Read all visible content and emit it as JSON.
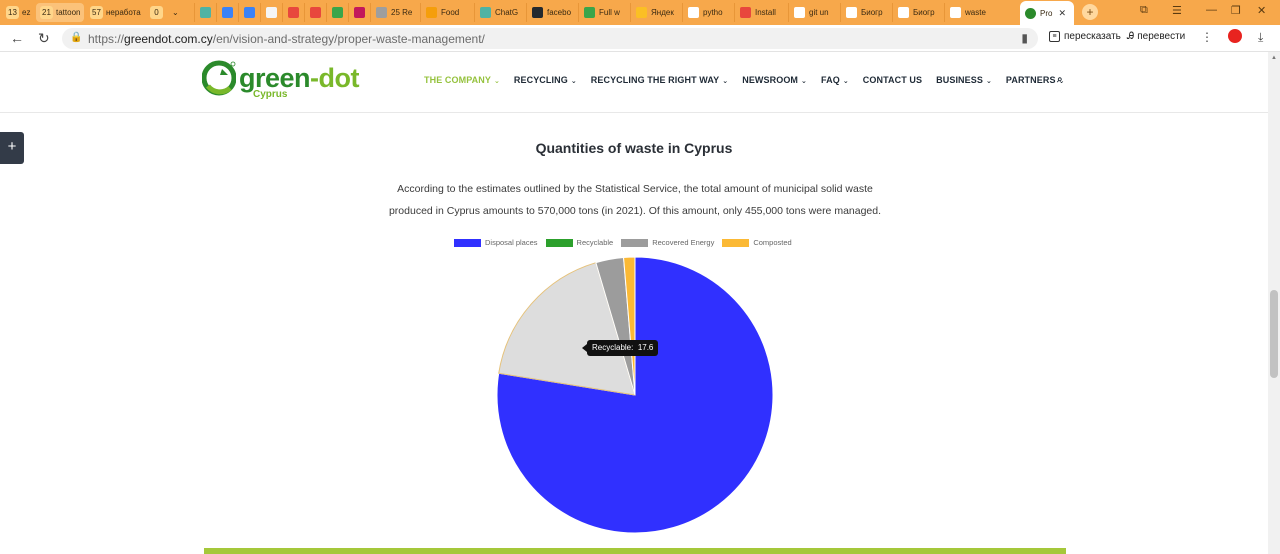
{
  "browser": {
    "tab_groups": [
      {
        "count": "13",
        "label": "ez"
      },
      {
        "count": "21",
        "label": "tattoon"
      },
      {
        "count": "57",
        "label": "неработа"
      },
      {
        "count": "0",
        "label": ""
      }
    ],
    "tabs": [
      {
        "label": "",
        "color": "#4fb3a3"
      },
      {
        "label": "",
        "color": "#3b82f6"
      },
      {
        "label": "",
        "color": "#3b82f6"
      },
      {
        "label": "",
        "color": "#f5f5f5"
      },
      {
        "label": "",
        "color": "#e8473d"
      },
      {
        "label": "",
        "color": "#e8473d"
      },
      {
        "label": "",
        "color": "#3aa54a"
      },
      {
        "label": "",
        "color": "#c2185b"
      },
      {
        "label": "25 Re",
        "color": "#9e9e9e"
      },
      {
        "label": "Food",
        "color": "#f59e0b"
      },
      {
        "label": "ChatG",
        "color": "#4fb3a3"
      },
      {
        "label": "facebo",
        "color": "#24292e"
      },
      {
        "label": "Full w",
        "color": "#3aa54a"
      },
      {
        "label": "Яндек",
        "color": "#fbbf24"
      },
      {
        "label": "pytho",
        "color": "#ffffff"
      },
      {
        "label": "Install",
        "color": "#e8473d"
      },
      {
        "label": "git un",
        "color": "#ffffff"
      },
      {
        "label": "Биогр",
        "color": "#ffffff"
      },
      {
        "label": "Биогр",
        "color": "#ffffff"
      },
      {
        "label": "waste",
        "color": "#ffffff"
      }
    ],
    "active_tab": {
      "label": "Pro"
    },
    "url": {
      "scheme": "https://",
      "host": "greendot.com.cy",
      "path": "/en/vision-and-strategy/proper-waste-management/"
    },
    "extensions": {
      "read_aloud": "пересказать",
      "translate": "перевести"
    }
  },
  "site": {
    "logo": {
      "brand": "green",
      "brand_dash": "-dot",
      "region": "Cyprus"
    },
    "nav": [
      {
        "label": "THE COMPANY",
        "current": true,
        "dropdown": true
      },
      {
        "label": "RECYCLING",
        "dropdown": true
      },
      {
        "label": "RECYCLING THE RIGHT WAY",
        "dropdown": true
      },
      {
        "label": "NEWSROOM",
        "dropdown": true
      },
      {
        "label": "FAQ",
        "dropdown": true
      },
      {
        "label": "CONTACT US",
        "dropdown": false
      },
      {
        "label": "BUSINESS",
        "dropdown": true
      },
      {
        "label": "PARTNERS",
        "dropdown": true
      }
    ]
  },
  "content": {
    "title": "Quantities of waste in Cyprus",
    "paragraph": "According to the estimates outlined by the Statistical Service, the total amount of municipal solid waste produced in Cyprus amounts to 570,000 tons (in 2021). Of this amount, only 455,000 tons were managed."
  },
  "chart_data": {
    "type": "pie",
    "series": [
      {
        "name": "Disposal places",
        "value": 76.2,
        "color": "#3030ff"
      },
      {
        "name": "Recyclable",
        "value": 17.6,
        "color": "#dddddd",
        "legend_color": "#2ca02c"
      },
      {
        "name": "Recovered Energy",
        "value": 3.2,
        "color": "#9c9c9c"
      },
      {
        "name": "Composted",
        "value": 1.3,
        "color": "#fbb935"
      }
    ],
    "legend_position": "top",
    "tooltip": {
      "label": "Recyclable:",
      "value": "17.6"
    }
  }
}
